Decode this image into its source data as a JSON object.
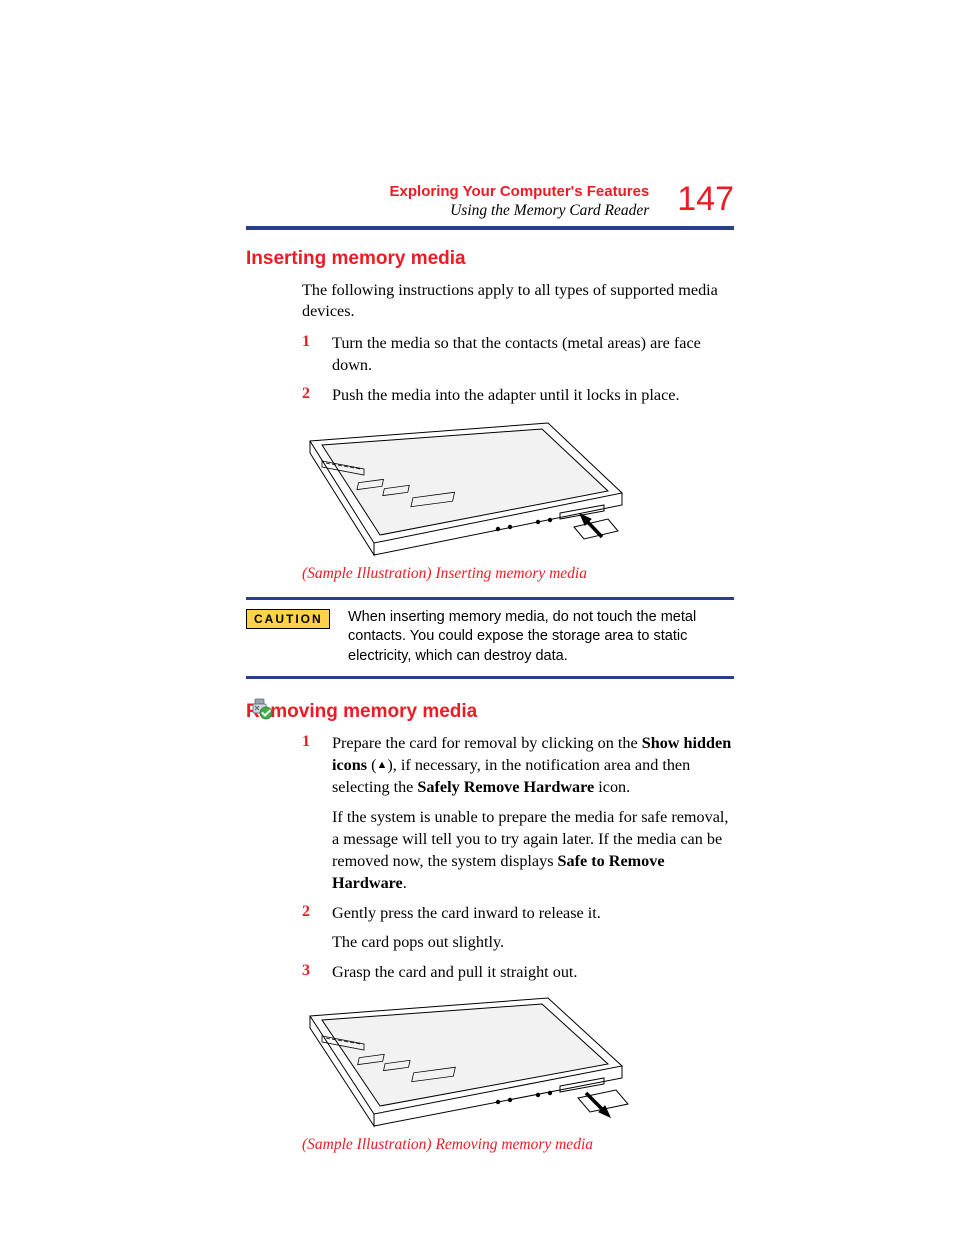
{
  "header": {
    "chapter": "Exploring Your Computer's Features",
    "section": "Using the Memory Card Reader",
    "page_number": "147"
  },
  "section1": {
    "heading": "Inserting memory media",
    "intro": "The following instructions apply to all types of supported media devices.",
    "steps": {
      "s1_num": "1",
      "s1_text": "Turn the media so that the contacts (metal areas) are face down.",
      "s2_num": "2",
      "s2_text": "Push the media into the adapter until it locks in place."
    },
    "caption": "(Sample Illustration) Inserting memory media"
  },
  "caution": {
    "label": "CAUTION",
    "text": "When inserting memory media, do not touch the metal contacts. You could expose the storage area to static electricity, which can destroy data."
  },
  "section2": {
    "heading": "Removing memory media",
    "steps": {
      "s1_num": "1",
      "s1_a": "Prepare the card for removal by clicking on the ",
      "s1_b": "Show hidden icons",
      "s1_c": " (",
      "s1_d": "), if necessary, in the notification area and then selecting the ",
      "s1_e": "Safely Remove Hardware",
      "s1_f": " icon.",
      "s1_p2a": "If the system is unable to prepare the media for safe removal, a message will tell you to try again later. If the media can be removed now, the system displays ",
      "s1_p2b": "Safe to Remove Hardware",
      "s1_p2c": ".",
      "s2_num": "2",
      "s2_text": "Gently press the card inward to release it.",
      "s2_sub": "The card pops out slightly.",
      "s3_num": "3",
      "s3_text": "Grasp the card and pull it straight out."
    },
    "caption": "(Sample Illustration) Removing memory media"
  },
  "icons": {
    "safely_remove": "safely-remove-hardware-icon",
    "up_triangle": "▲"
  }
}
